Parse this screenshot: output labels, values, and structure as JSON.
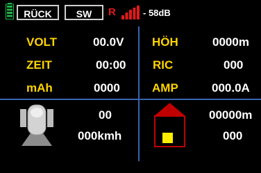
{
  "header": {
    "back_label": "RÜCK",
    "sw_label": "SW",
    "receiver_letter": "R",
    "signal_db": "- 58dB"
  },
  "colors": {
    "background": "#000000",
    "label": "#ffd400",
    "value": "#ffffff",
    "grid": "#3a63b0",
    "battery": "#22b14c",
    "signal": "#e01a1a",
    "house_roof": "#c00000",
    "house_window": "#ffee00"
  },
  "left_rows": [
    {
      "label": "VOLT",
      "value": "00.0V"
    },
    {
      "label": "ZEIT",
      "value": "00:00"
    },
    {
      "label": "mAh",
      "value": "0000"
    }
  ],
  "right_rows": [
    {
      "label": "HÖH",
      "value": "0000m"
    },
    {
      "label": "RIC",
      "value": "000"
    },
    {
      "label": "AMP",
      "value": "000.0A"
    }
  ],
  "bottom_left": {
    "icon": "vario-sensor-icon",
    "value1": "00",
    "value2": "000kmh"
  },
  "bottom_right": {
    "icon": "home-icon",
    "value1": "00000m",
    "value2": "000"
  }
}
